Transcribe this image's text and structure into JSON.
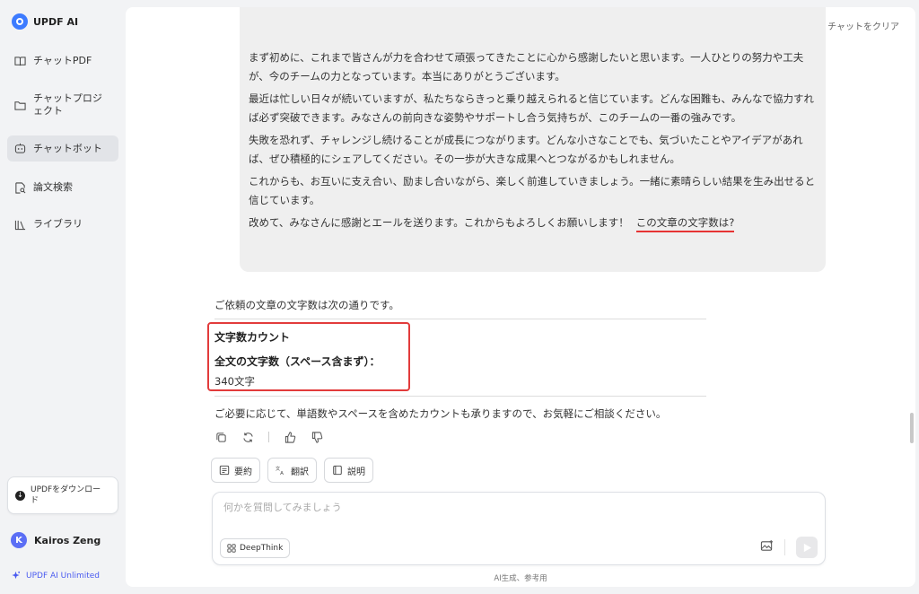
{
  "app": {
    "title": "UPDF AI"
  },
  "sidebar": {
    "items": [
      {
        "label": "チャットPDF",
        "icon": "book-icon"
      },
      {
        "label": "チャットプロジェクト",
        "icon": "folder-icon"
      },
      {
        "label": "チャットボット",
        "icon": "bot-icon",
        "active": true
      },
      {
        "label": "論文検索",
        "icon": "paper-search-icon"
      },
      {
        "label": "ライブラリ",
        "icon": "library-icon"
      }
    ],
    "download_label": "UPDFをダウンロード",
    "user_initial": "K",
    "user_name": "Kairos Zeng",
    "unlimited_label": "UPDF AI Unlimited"
  },
  "header": {
    "clear_label": "チャットをクリア"
  },
  "conversation": {
    "user_message": {
      "paragraphs": [
        "まず初めに、これまで皆さんが力を合わせて頑張ってきたことに心から感謝したいと思います。一人ひとりの努力や工夫が、今のチームの力となっています。本当にありがとうございます。",
        "最近は忙しい日々が続いていますが、私たちならきっと乗り越えられると信じています。どんな困難も、みんなで協力すれば必ず突破できます。みなさんの前向きな姿勢やサポートし合う気持ちが、このチームの一番の強みです。",
        "失敗を恐れず、チャレンジし続けることが成長につながります。どんな小さなことでも、気づいたことやアイデアがあれば、ぜひ積極的にシェアしてください。その一歩が大きな成果へとつながるかもしれません。",
        "これからも、お互いに支え合い、励まし合いながら、楽しく前進していきましょう。一緒に素晴らしい結果を生み出せると信じています。"
      ],
      "last_line": "改めて、みなさんに感謝とエールを送ります。これからもよろしくお願いします！",
      "question": "この文章の文字数は?"
    },
    "answer": {
      "intro": "ご依頼の文章の文字数は次の通りです。",
      "heading": "文字数カウント",
      "subheading": "全文の文字数（スペース含まず）：",
      "value": "340文字",
      "outro": "ご必要に応じて、単語数やスペースを含めたカウントも承りますので、お気軽にご相談ください。"
    }
  },
  "quick_actions": {
    "summarize": "要約",
    "translate": "翻訳",
    "explain": "説明"
  },
  "composer": {
    "placeholder": "何かを質問してみましょう",
    "deepthink_label": "DeepThink"
  },
  "footer": {
    "note": "AI生成、参考用"
  },
  "colors": {
    "accent": "#4a5bf0",
    "highlight": "#e23b3b",
    "bubble": "#efefef"
  }
}
